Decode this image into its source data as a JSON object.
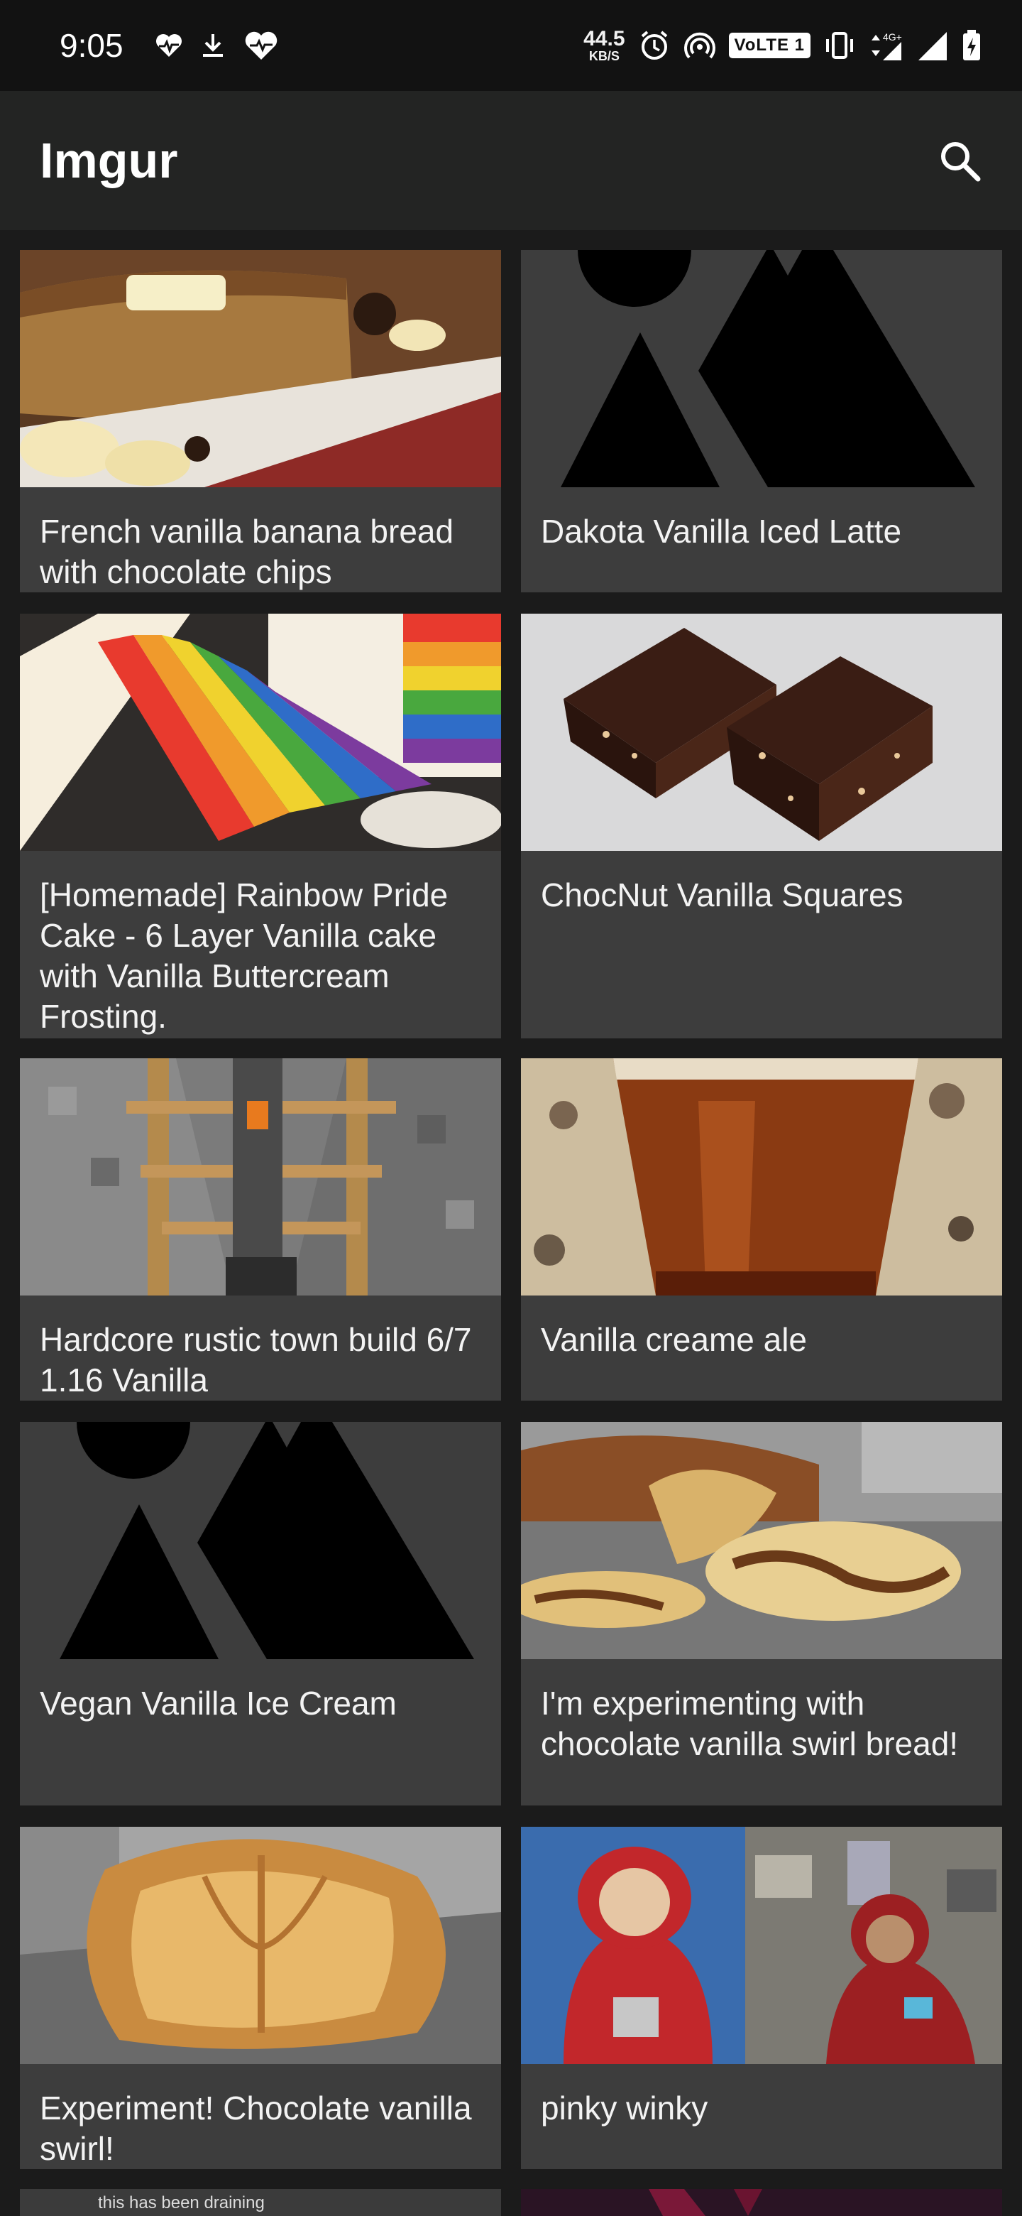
{
  "status_bar": {
    "time": "9:05",
    "speed_value": "44.5",
    "speed_unit": "KB/S",
    "volte_label": "VoLTE 1",
    "network_label": "4G+"
  },
  "app_bar": {
    "title": "Imgur",
    "search_icon": "search-icon"
  },
  "results": [
    {
      "title": "French vanilla banana bread with chocolate chips",
      "image": "banana-bread-photo"
    },
    {
      "title": "Dakota Vanilla Iced Latte",
      "image": "image-placeholder-icon"
    },
    {
      "title": "[Homemade] Rainbow Pride Cake - 6 Layer Vanilla cake with Vanilla Buttercream Frosting.",
      "image": "rainbow-cake-photo"
    },
    {
      "title": "ChocNut Vanilla Squares",
      "image": "chocolate-squares-photo"
    },
    {
      "title": "Hardcore rustic town build 6/7 1.16 Vanilla",
      "image": "minecraft-mineshaft-screenshot"
    },
    {
      "title": "Vanilla creame ale",
      "image": "beer-glass-photo"
    },
    {
      "title": "Vegan Vanilla Ice Cream",
      "image": "image-placeholder-icon"
    },
    {
      "title": "I'm experimenting with chocolate vanilla swirl bread!",
      "image": "swirl-bread-photo"
    },
    {
      "title": "Experiment! Chocolate vanilla swirl!",
      "image": "bread-loaf-photo"
    },
    {
      "title": "pinky winky",
      "image": "teletubby-photo"
    }
  ],
  "peek": {
    "left_text": "this has been draining"
  }
}
